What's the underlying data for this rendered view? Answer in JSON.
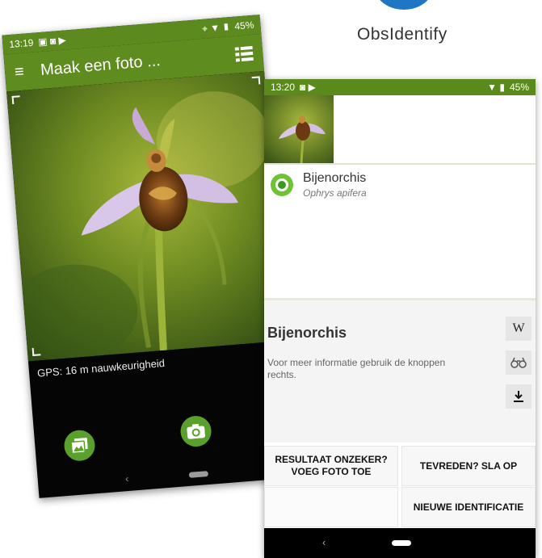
{
  "brand": {
    "name": "ObsIdentify",
    "color": "#1f76c4"
  },
  "phone1": {
    "status": {
      "time": "13:19",
      "battery": "45%"
    },
    "appbar": {
      "title": "Maak een foto ..."
    },
    "gps_text": "GPS: 16 m nauwkeurigheid",
    "icons": [
      "menu-icon",
      "list-icon",
      "gallery-icon",
      "camera-icon",
      "back-icon",
      "home-icon"
    ]
  },
  "phone2": {
    "status": {
      "time": "13:20",
      "battery": "45%"
    },
    "result": {
      "common_name": "Bijenorchis",
      "scientific_name": "Ophrys apifera"
    },
    "detail": {
      "title": "Bijenorchis",
      "info": "Voor meer informatie gebruik de knoppen rechts.",
      "wiki_label": "W"
    },
    "actions": {
      "uncertain_line1": "RESULTAAT ONZEKER?",
      "uncertain_line2": "VOEG FOTO TOE",
      "save": "TEVREDEN? SLA OP",
      "new": "NIEUWE IDENTIFICATIE"
    }
  },
  "colors": {
    "green_bar": "#5f8c1f",
    "button_green": "#5aa02c",
    "result_green": "#6dc236"
  }
}
